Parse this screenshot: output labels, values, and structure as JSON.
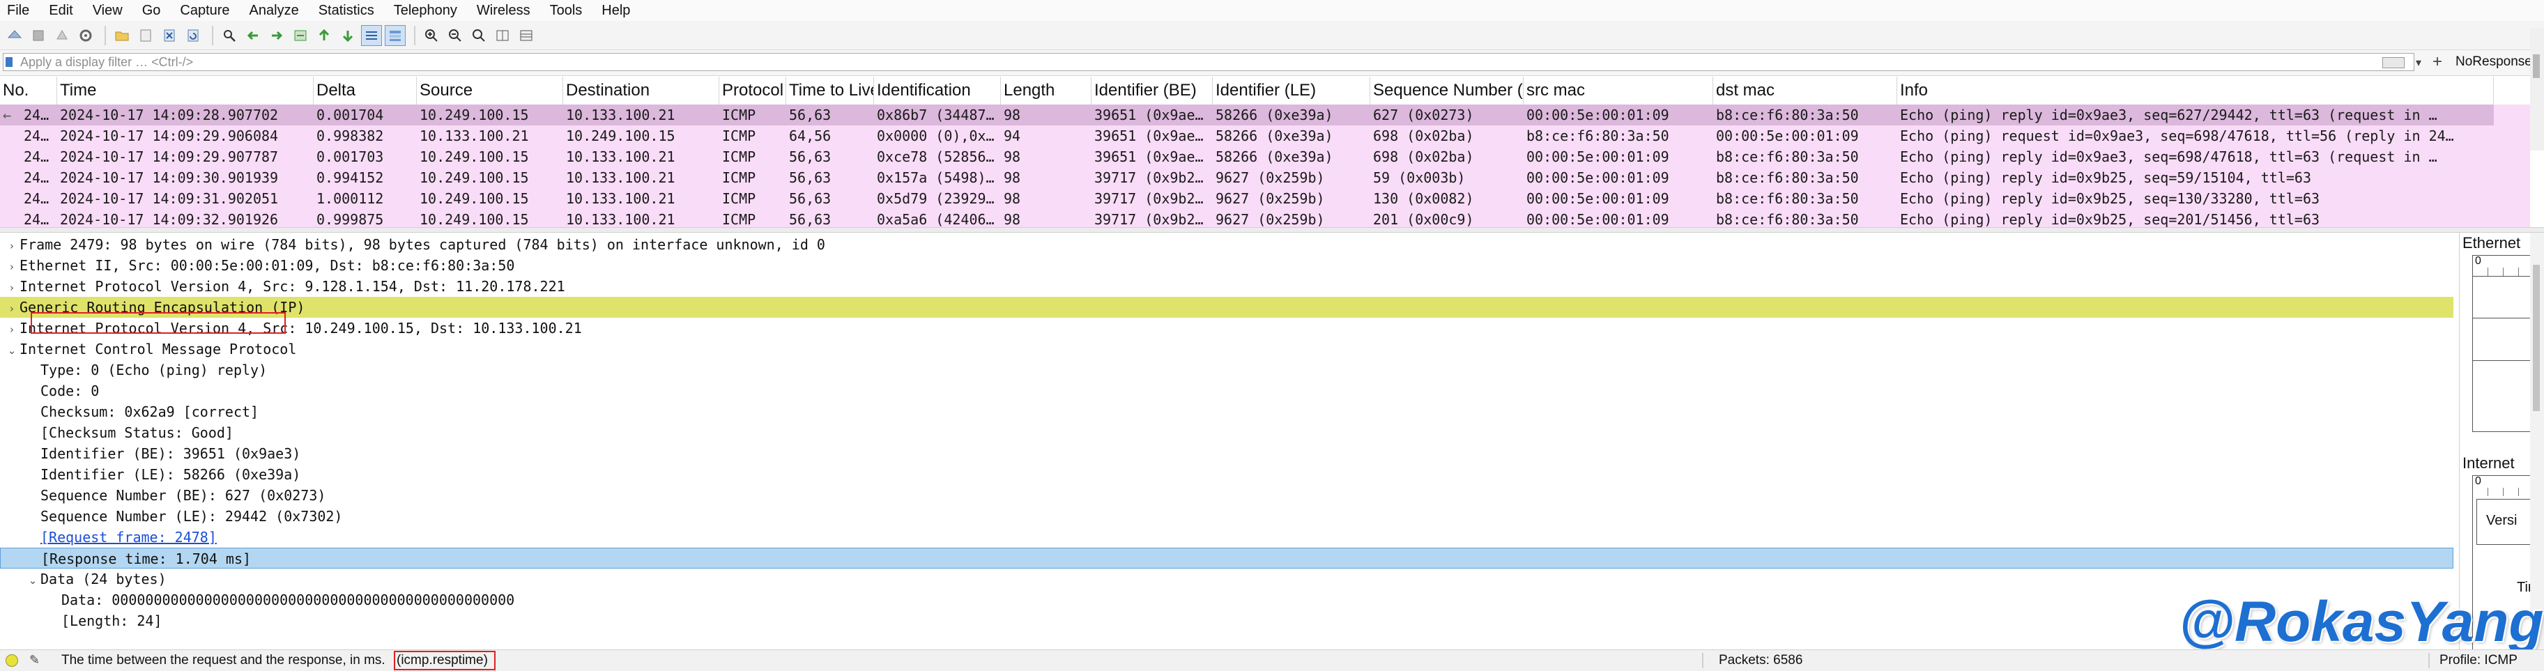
{
  "menu": [
    "File",
    "Edit",
    "View",
    "Go",
    "Capture",
    "Analyze",
    "Statistics",
    "Telephony",
    "Wireless",
    "Tools",
    "Help"
  ],
  "toolbar": {
    "icons": [
      "shark-start-icon",
      "stop-icon",
      "restart-icon",
      "options-gear-icon",
      "open-folder-icon",
      "save-file-icon",
      "close-file-icon",
      "reload-icon",
      "find-icon",
      "back-arrow-icon",
      "forward-arrow-icon",
      "go-to-packet-icon",
      "first-packet-icon",
      "last-packet-icon",
      "autoscroll-icon",
      "colorize-icon",
      "zoom-in-icon",
      "zoom-out-icon",
      "zoom-normal-icon",
      "resize-columns-icon",
      "expand-icon"
    ]
  },
  "filter": {
    "placeholder": "Apply a display filter … <Ctrl-/>",
    "noresponse_label": "NoResponse",
    "plus": "+"
  },
  "packet_list": {
    "columns": [
      "No.",
      "Time",
      "Delta",
      "Source",
      "Destination",
      "Protocol",
      "Time to Live",
      "Identification",
      "Length",
      "Identifier (BE)",
      "Identifier (LE)",
      "Sequence Number (",
      "src mac",
      "dst mac",
      "Info"
    ],
    "rows": [
      {
        "no": "24…",
        "arrow": "←",
        "time": "2024-10-17 14:09:28.907702",
        "delta": "0.001704",
        "src": "10.249.100.15",
        "dst": "10.133.100.21",
        "proto": "ICMP",
        "ttl": "56,63",
        "ident": "0x86b7 (34487…",
        "len": "98",
        "idbe": "39651 (0x9ae…",
        "idle": "58266 (0xe39a)",
        "seq": "627 (0x0273)",
        "srcmac": "00:00:5e:00:01:09",
        "dstmac": "b8:ce:f6:80:3a:50",
        "info": "Echo (ping) reply    id=0x9ae3, seq=627/29442, ttl=63 (request in …"
      },
      {
        "no": "24…",
        "arrow": "",
        "time": "2024-10-17 14:09:29.906084",
        "delta": "0.998382",
        "src": "10.133.100.21",
        "dst": "10.249.100.15",
        "proto": "ICMP",
        "ttl": "64,56",
        "ident": "0x0000 (0),0x…",
        "len": "94",
        "idbe": "39651 (0x9ae…",
        "idle": "58266 (0xe39a)",
        "seq": "698 (0x02ba)",
        "srcmac": "b8:ce:f6:80:3a:50",
        "dstmac": "00:00:5e:00:01:09",
        "info": "Echo (ping) request  id=0x9ae3, seq=698/47618, ttl=56 (reply in 24…"
      },
      {
        "no": "24…",
        "arrow": "",
        "time": "2024-10-17 14:09:29.907787",
        "delta": "0.001703",
        "src": "10.249.100.15",
        "dst": "10.133.100.21",
        "proto": "ICMP",
        "ttl": "56,63",
        "ident": "0xce78 (52856…",
        "len": "98",
        "idbe": "39651 (0x9ae…",
        "idle": "58266 (0xe39a)",
        "seq": "698 (0x02ba)",
        "srcmac": "00:00:5e:00:01:09",
        "dstmac": "b8:ce:f6:80:3a:50",
        "info": "Echo (ping) reply    id=0x9ae3, seq=698/47618, ttl=63 (request in …"
      },
      {
        "no": "24…",
        "arrow": "",
        "time": "2024-10-17 14:09:30.901939",
        "delta": "0.994152",
        "src": "10.249.100.15",
        "dst": "10.133.100.21",
        "proto": "ICMP",
        "ttl": "56,63",
        "ident": "0x157a (5498)…",
        "len": "98",
        "idbe": "39717 (0x9b2…",
        "idle": "9627 (0x259b)",
        "seq": "59 (0x003b)",
        "srcmac": "00:00:5e:00:01:09",
        "dstmac": "b8:ce:f6:80:3a:50",
        "info": "Echo (ping) reply    id=0x9b25, seq=59/15104, ttl=63"
      },
      {
        "no": "24…",
        "arrow": "",
        "time": "2024-10-17 14:09:31.902051",
        "delta": "1.000112",
        "src": "10.249.100.15",
        "dst": "10.133.100.21",
        "proto": "ICMP",
        "ttl": "56,63",
        "ident": "0x5d79 (23929…",
        "len": "98",
        "idbe": "39717 (0x9b2…",
        "idle": "9627 (0x259b)",
        "seq": "130 (0x0082)",
        "srcmac": "00:00:5e:00:01:09",
        "dstmac": "b8:ce:f6:80:3a:50",
        "info": "Echo (ping) reply    id=0x9b25, seq=130/33280, ttl=63"
      },
      {
        "no": "24…",
        "arrow": "",
        "time": "2024-10-17 14:09:32.901926",
        "delta": "0.999875",
        "src": "10.249.100.15",
        "dst": "10.133.100.21",
        "proto": "ICMP",
        "ttl": "56,63",
        "ident": "0xa5a6 (42406…",
        "len": "98",
        "idbe": "39717 (0x9b2…",
        "idle": "9627 (0x259b)",
        "seq": "201 (0x00c9)",
        "srcmac": "00:00:5e:00:01:09",
        "dstmac": "b8:ce:f6:80:3a:50",
        "info": "Echo (ping) reply    id=0x9b25, seq=201/51456, ttl=63"
      }
    ]
  },
  "details": [
    {
      "text": "Frame 2479: 98 bytes on wire (784 bits), 98 bytes captured (784 bits) on interface unknown, id 0",
      "tri": "›"
    },
    {
      "text": "Ethernet II, Src: 00:00:5e:00:01:09, Dst: b8:ce:f6:80:3a:50",
      "tri": "›"
    },
    {
      "text": "Internet Protocol Version 4, Src: 9.128.1.154, Dst: 11.20.178.221",
      "tri": "›"
    },
    {
      "text": "Generic Routing Encapsulation (IP)",
      "tri": "›"
    },
    {
      "text": "Internet Protocol Version 4, Src: 10.249.100.15, Dst: 10.133.100.21",
      "tri": "›"
    },
    {
      "text": "Internet Control Message Protocol",
      "tri": "⌄"
    },
    {
      "text": "Type: 0 (Echo (ping) reply)"
    },
    {
      "text": "Code: 0"
    },
    {
      "text": "Checksum: 0x62a9 [correct]"
    },
    {
      "text": "[Checksum Status: Good]"
    },
    {
      "text": "Identifier (BE): 39651 (0x9ae3)"
    },
    {
      "text": "Identifier (LE): 58266 (0xe39a)"
    },
    {
      "text": "Sequence Number (BE): 627 (0x0273)"
    },
    {
      "text": "Sequence Number (LE): 29442 (0x7302)"
    },
    {
      "text": "[Request frame: 2478]"
    },
    {
      "text": "[Response time: 1.704 ms]"
    },
    {
      "text": "Data (24 bytes)",
      "tri": "⌄"
    },
    {
      "text": "Data: 000000000000000000000000000000000000000000000000"
    },
    {
      "text": "[Length: 24]"
    }
  ],
  "bytes_pane": {
    "label1": "Ethernet",
    "tick1": "0",
    "label2": "Internet",
    "tick2": "0",
    "item1": "Versi",
    "item2": "Tir"
  },
  "watermark": "@RokasYang",
  "status": {
    "message": "The time between the request and the response, in ms.",
    "field": "(icmp.resptime)",
    "packets": "Packets: 6586",
    "profile": "Profile: ICMP"
  },
  "colors": {
    "row_pink": "#f9dcf7",
    "row_selected": "#dcb8dc",
    "gre_highlight": "#dfe36a",
    "detail_selected": "#b3d7f2",
    "annotation_red": "#e02020",
    "watermark_blue": "#1d6fd1"
  }
}
